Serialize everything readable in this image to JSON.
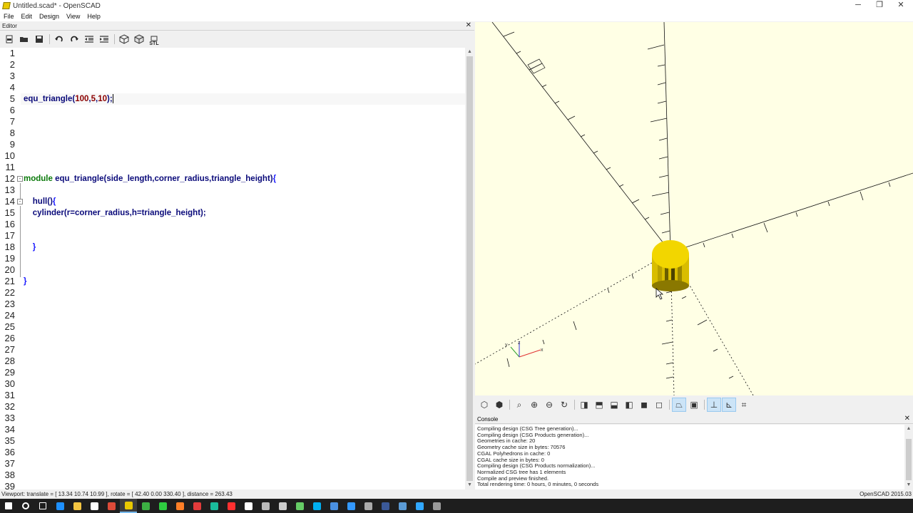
{
  "window": {
    "title": "Untitled.scad* - OpenSCAD",
    "minimize": "─",
    "restore": "❐",
    "close": "✕"
  },
  "menu": [
    "File",
    "Edit",
    "Design",
    "View",
    "Help"
  ],
  "editor": {
    "title": "Editor",
    "close": "✕",
    "toolbar": [
      {
        "name": "new-icon",
        "glyph": "▪"
      },
      {
        "name": "open-icon",
        "glyph": "▬"
      },
      {
        "name": "save-icon",
        "glyph": "■"
      },
      {
        "name": "undo-icon",
        "glyph": "↶"
      },
      {
        "name": "redo-icon",
        "glyph": "↷"
      },
      {
        "name": "unindent-icon",
        "glyph": "⇤"
      },
      {
        "name": "indent-icon",
        "glyph": "⇥"
      },
      {
        "name": "preview-icon",
        "glyph": "⬡"
      },
      {
        "name": "render-icon",
        "glyph": "⬢"
      },
      {
        "name": "export-stl-icon",
        "glyph": "STL"
      }
    ],
    "line_count": 39,
    "code_lines": [
      {
        "n": 1,
        "text": ""
      },
      {
        "n": 2,
        "text": ""
      },
      {
        "n": 3,
        "text": ""
      },
      {
        "n": 4,
        "text": ""
      },
      {
        "n": 5,
        "text": "equ_triangle(100,5,10);"
      },
      {
        "n": 6,
        "text": ""
      },
      {
        "n": 7,
        "text": ""
      },
      {
        "n": 8,
        "text": ""
      },
      {
        "n": 9,
        "text": ""
      },
      {
        "n": 10,
        "text": ""
      },
      {
        "n": 11,
        "text": ""
      },
      {
        "n": 12,
        "text": "module equ_triangle(side_length,corner_radius,triangle_height){"
      },
      {
        "n": 13,
        "text": ""
      },
      {
        "n": 14,
        "text": "    hull(){"
      },
      {
        "n": 15,
        "text": "    cylinder(r=corner_radius,h=triangle_height);"
      },
      {
        "n": 16,
        "text": ""
      },
      {
        "n": 17,
        "text": ""
      },
      {
        "n": 18,
        "text": "    }"
      },
      {
        "n": 19,
        "text": ""
      },
      {
        "n": 20,
        "text": ""
      },
      {
        "n": 21,
        "text": "}"
      }
    ]
  },
  "view_toolbar": [
    "preview-icon",
    "render-icon",
    "view-all-icon",
    "zoom-in-icon",
    "zoom-out-icon",
    "reset-view-icon",
    "view-right-icon",
    "view-top-icon",
    "view-bottom-icon",
    "view-left-icon",
    "view-front-icon",
    "view-back-icon",
    "perspective-icon",
    "orthogonal-icon",
    "show-axes-icon",
    "show-scale-icon",
    "show-edges-icon"
  ],
  "console": {
    "title": "Console",
    "close": "✕",
    "lines": [
      "Compiling design (CSG Tree generation)...",
      "Compiling design (CSG Products generation)...",
      "Geometries in cache: 20",
      "Geometry cache size in bytes: 70576",
      "CGAL Polyhedrons in cache: 0",
      "CGAL cache size in bytes: 0",
      "Compiling design (CSG Products normalization)...",
      "Normalized CSG tree has 1 elements",
      "Compile and preview finished.",
      "Total rendering time: 0 hours, 0 minutes, 0 seconds"
    ]
  },
  "status": {
    "viewport": "Viewport: translate = [ 13.34 10.74 10.99 ], rotate = [ 42.40 0.00 330.40 ], distance = 263.43",
    "version": "OpenSCAD 2015.03"
  },
  "colors": {
    "viewport_bg": "#ffffe5",
    "cylinder": "#f2d600",
    "keyword": "#0b7a0b",
    "number": "#8b0000"
  },
  "taskbar": [
    {
      "name": "start-icon",
      "color": "#ffffff"
    },
    {
      "name": "search-icon",
      "color": "#ffffff"
    },
    {
      "name": "task-view-icon",
      "color": "#ffffff"
    },
    {
      "name": "edge-icon",
      "color": "#1e90ff"
    },
    {
      "name": "explorer-icon",
      "color": "#f4c542"
    },
    {
      "name": "store-icon",
      "color": "#ffffff"
    },
    {
      "name": "chrome-icon",
      "color": "#dd4b39"
    },
    {
      "name": "openscad-icon",
      "color": "#e8c800"
    },
    {
      "name": "app-green-icon",
      "color": "#3cb043"
    },
    {
      "name": "app-clover-icon",
      "color": "#2ecc40"
    },
    {
      "name": "app-orange-icon",
      "color": "#ff7f27"
    },
    {
      "name": "app-red-icon",
      "color": "#e23b3b"
    },
    {
      "name": "app-teal-icon",
      "color": "#1abc9c"
    },
    {
      "name": "app-red2-icon",
      "color": "#ff3030"
    },
    {
      "name": "notepad-icon",
      "color": "#ffffff"
    },
    {
      "name": "app-box-icon",
      "color": "#bbbbbb"
    },
    {
      "name": "calc-icon",
      "color": "#cccccc"
    },
    {
      "name": "app-pen-icon",
      "color": "#66cc66"
    },
    {
      "name": "skype-icon",
      "color": "#00aff0"
    },
    {
      "name": "app-blue-icon",
      "color": "#4a90e2"
    },
    {
      "name": "app-globe-icon",
      "color": "#3399ff"
    },
    {
      "name": "app-dragon-icon",
      "color": "#aaaaaa"
    },
    {
      "name": "facebook-icon",
      "color": "#3b5998"
    },
    {
      "name": "app-window-icon",
      "color": "#5b9bd5"
    },
    {
      "name": "photoshop-icon",
      "color": "#31a8ff"
    },
    {
      "name": "app-misc-icon",
      "color": "#999999"
    }
  ]
}
